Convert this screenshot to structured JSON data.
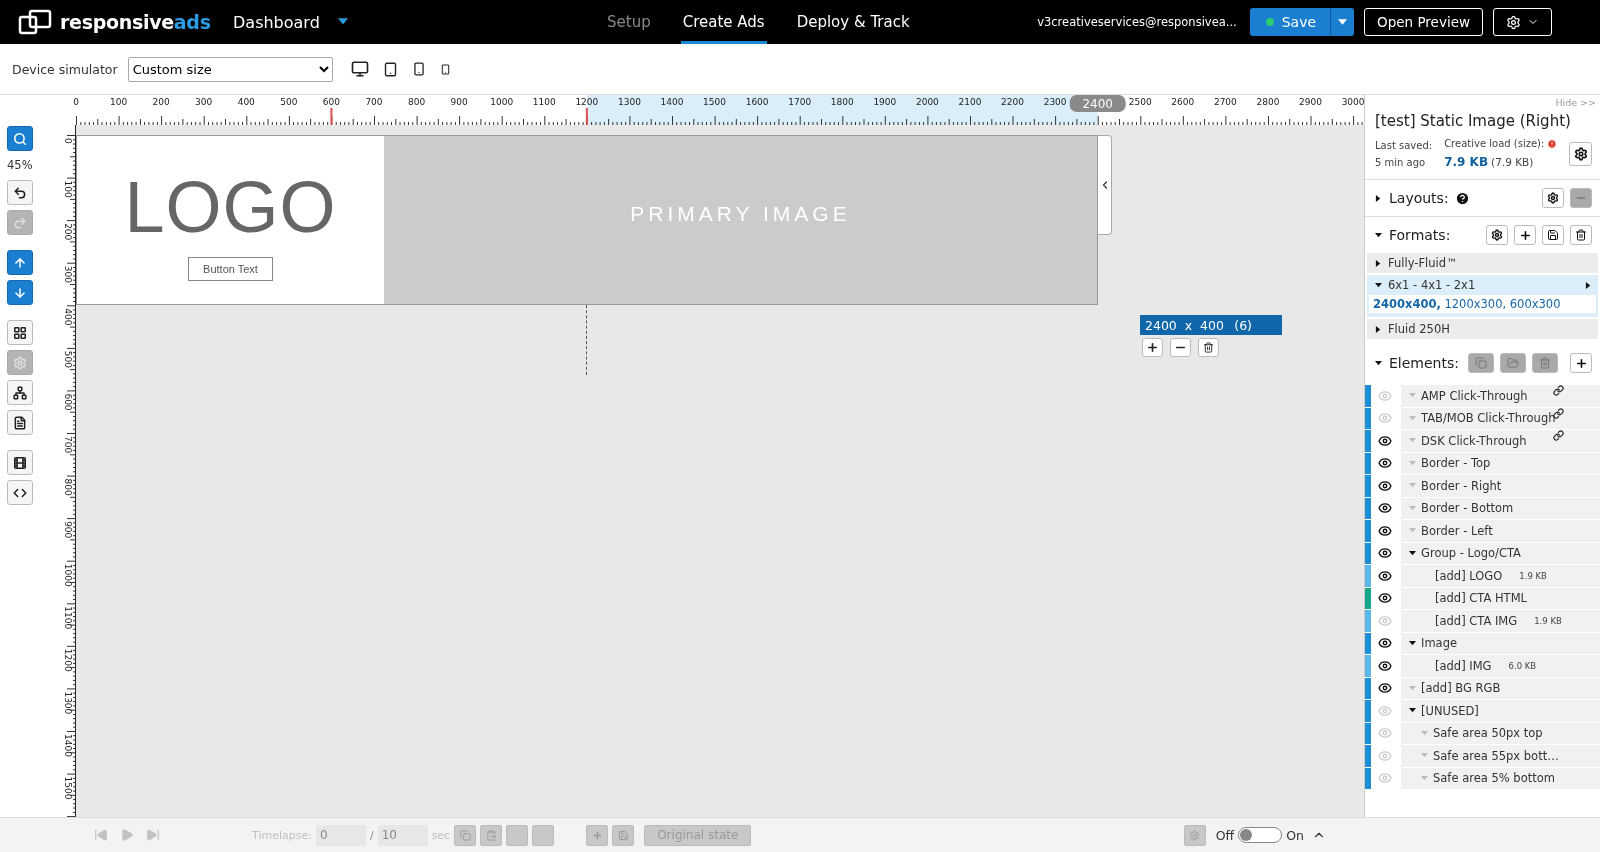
{
  "header": {
    "brand": {
      "first": "responsive",
      "second": "ads"
    },
    "menu": "Dashboard",
    "nav": [
      {
        "label": "Setup",
        "selected": false,
        "disabled": true
      },
      {
        "label": "Create Ads",
        "selected": true,
        "disabled": false
      },
      {
        "label": "Deploy & Track",
        "selected": false,
        "disabled": false
      }
    ],
    "user": "v3creativeservices@responsivea...",
    "save": "Save",
    "preview": "Open Preview"
  },
  "device_bar": {
    "label": "Device simulator",
    "select": "Custom size",
    "devices": [
      {
        "kind": "desktop"
      },
      {
        "kind": "tablet"
      },
      {
        "kind": "phone"
      },
      {
        "kind": "small-phone"
      }
    ]
  },
  "toolbar": {
    "zoom": "45%",
    "groups": [
      [
        {
          "kind": "search",
          "primary": true,
          "disabled": false
        }
      ],
      [
        {
          "kind": "undo",
          "primary": false,
          "disabled": false
        },
        {
          "kind": "redo",
          "primary": false,
          "disabled": true
        }
      ],
      [
        {
          "kind": "up",
          "primary": true,
          "disabled": false
        },
        {
          "kind": "down",
          "primary": true,
          "disabled": false
        }
      ],
      [
        {
          "kind": "layers",
          "primary": false,
          "disabled": false
        },
        {
          "kind": "settings",
          "primary": false,
          "disabled": true
        },
        {
          "kind": "hierarchy",
          "primary": false,
          "disabled": false
        },
        {
          "kind": "document",
          "primary": false,
          "disabled": false
        }
      ],
      [
        {
          "kind": "film",
          "primary": false,
          "disabled": false
        },
        {
          "kind": "code",
          "primary": false,
          "disabled": false
        }
      ]
    ]
  },
  "rulers": {
    "horizontal": [
      "0",
      "100",
      "200",
      "300",
      "400",
      "500",
      "600",
      "700",
      "800",
      "900",
      "1000",
      "1100",
      "1200",
      "1300",
      "1400",
      "1500",
      "1600",
      "1700",
      "1800",
      "1900",
      "2000",
      "2100",
      "2200",
      "2300",
      "2500",
      "2600",
      "2700",
      "2800",
      "2900",
      "3000"
    ],
    "vertical": [
      "0",
      "100",
      "200",
      "300",
      "400",
      "500",
      "600",
      "700",
      "800",
      "900",
      "1000",
      "1100",
      "1200",
      "1300",
      "1400",
      "1500"
    ],
    "marker": "2400"
  },
  "canvas": {
    "logo": "LOGO",
    "button": "Button Text",
    "image": "PRIMARY IMAGE",
    "size": "2400  x  400",
    "count": "(6)"
  },
  "panel": {
    "hide": "Hide >>",
    "title": "[test] Static Image (Right)",
    "saved_label": "Last saved:",
    "saved_value": "5 min ago",
    "load_label": "Creative load (size):",
    "load_value": "7.9 KB",
    "load_raw": "(7.9 KB)",
    "layouts": {
      "label": "Layouts:",
      "expanded": false
    },
    "formats": {
      "label": "Formats:",
      "expanded": true,
      "items": [
        {
          "label": "Fully-Fluid™",
          "expanded": false,
          "selected": false
        },
        {
          "label": "6x1 - 4x1 - 2x1",
          "expanded": true,
          "selected": true,
          "sizes": "**2400x400,** 1200x300, 600x300"
        },
        {
          "label": "Fluid 250H",
          "expanded": false,
          "selected": false
        }
      ]
    },
    "elements": {
      "label": "Elements:",
      "expanded": true,
      "items": [
        {
          "kind": "layer",
          "name": "AMP Click-Through",
          "visible": false,
          "linked": true,
          "color": "#1e8fd5"
        },
        {
          "kind": "layer",
          "name": "TAB/MOB Click-Through",
          "visible": false,
          "linked": true,
          "color": "#1e8fd5"
        },
        {
          "kind": "layer",
          "name": "DSK Click-Through",
          "visible": true,
          "linked": true,
          "color": "#1e8fd5"
        },
        {
          "kind": "layer",
          "name": "Border - Top",
          "visible": true,
          "linked": false,
          "color": "#1e8fd5"
        },
        {
          "kind": "layer",
          "name": "Border - Right",
          "visible": true,
          "linked": false,
          "color": "#1e8fd5"
        },
        {
          "kind": "layer",
          "name": "Border - Bottom",
          "visible": true,
          "linked": false,
          "color": "#1e8fd5"
        },
        {
          "kind": "layer",
          "name": "Border - Left",
          "visible": true,
          "linked": false,
          "color": "#1e8fd5"
        },
        {
          "kind": "group",
          "name": "Group - Logo/CTA",
          "visible": true,
          "linked": false,
          "expanded": true,
          "color": "#1e8fd5",
          "children": [
            {
              "kind": "asset",
              "name": "[add] LOGO",
              "size": "1.9 KB",
              "visible": true,
              "linked": false,
              "color": "#5ab8e6"
            },
            {
              "kind": "asset",
              "name": "[add] CTA HTML",
              "visible": true,
              "linked": false,
              "color": "#17a589"
            },
            {
              "kind": "asset",
              "name": "[add] CTA IMG",
              "size": "1.9 KB",
              "visible": false,
              "linked": false,
              "color": "#5ab8e6"
            }
          ]
        },
        {
          "kind": "group",
          "name": "Image",
          "visible": true,
          "linked": false,
          "expanded": true,
          "color": "#1e8fd5",
          "children": [
            {
              "kind": "asset",
              "name": "[add] IMG",
              "size": "6.0 KB",
              "visible": true,
              "linked": false,
              "color": "#5ab8e6"
            }
          ]
        },
        {
          "kind": "layer",
          "name": "[add] BG RGB",
          "visible": true,
          "linked": false,
          "color": "#1e8fd5"
        },
        {
          "kind": "group",
          "name": "[UNUSED]",
          "visible": false,
          "linked": false,
          "expanded": true,
          "color": "#1e8fd5",
          "children": [
            {
              "kind": "layer",
              "name": "Safe area 50px top",
              "visible": false,
              "linked": false,
              "color": "#1e8fd5"
            },
            {
              "kind": "layer",
              "name": "Safe area 55px bott…",
              "visible": false,
              "linked": false,
              "color": "#1e8fd5"
            },
            {
              "kind": "layer",
              "name": "Safe area 5% bottom",
              "visible": false,
              "linked": false,
              "color": "#1e8fd5"
            }
          ]
        }
      ]
    }
  },
  "bottom": {
    "timelapse": "Timelapse:",
    "start": "0",
    "slash": "/",
    "end": "10",
    "unit": "sec",
    "original": "Original state",
    "off": "Off",
    "on": "On",
    "toggle_on": false
  }
}
